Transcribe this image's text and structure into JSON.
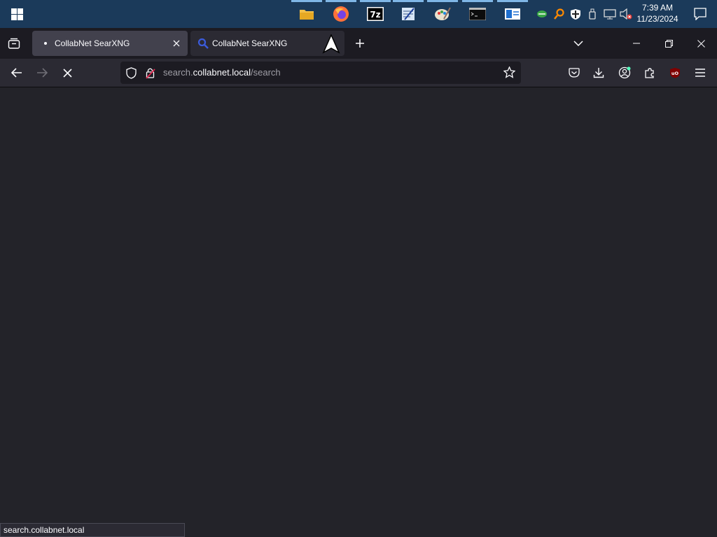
{
  "taskbar": {
    "apps": [
      {
        "name": "file-explorer-icon"
      },
      {
        "name": "firefox-icon"
      },
      {
        "name": "7zip-icon"
      },
      {
        "name": "notepad-icon"
      },
      {
        "name": "paint-icon"
      },
      {
        "name": "terminal-icon"
      },
      {
        "name": "window-app-icon"
      }
    ],
    "clock": {
      "time": "7:39 AM",
      "date": "11/23/2024"
    }
  },
  "browser": {
    "tabs": [
      {
        "title": "CollabNet SearXNG",
        "active": true
      },
      {
        "title": "CollabNet SearXNG",
        "active": false
      }
    ],
    "url": {
      "host_prefix": "search.",
      "host_domain": "collabnet.local",
      "path": "/search"
    }
  },
  "status": {
    "text": "search.collabnet.local"
  },
  "colors": {
    "accent": "#7fb6e6",
    "toolbar": "#2b2a33",
    "content": "#232329"
  }
}
